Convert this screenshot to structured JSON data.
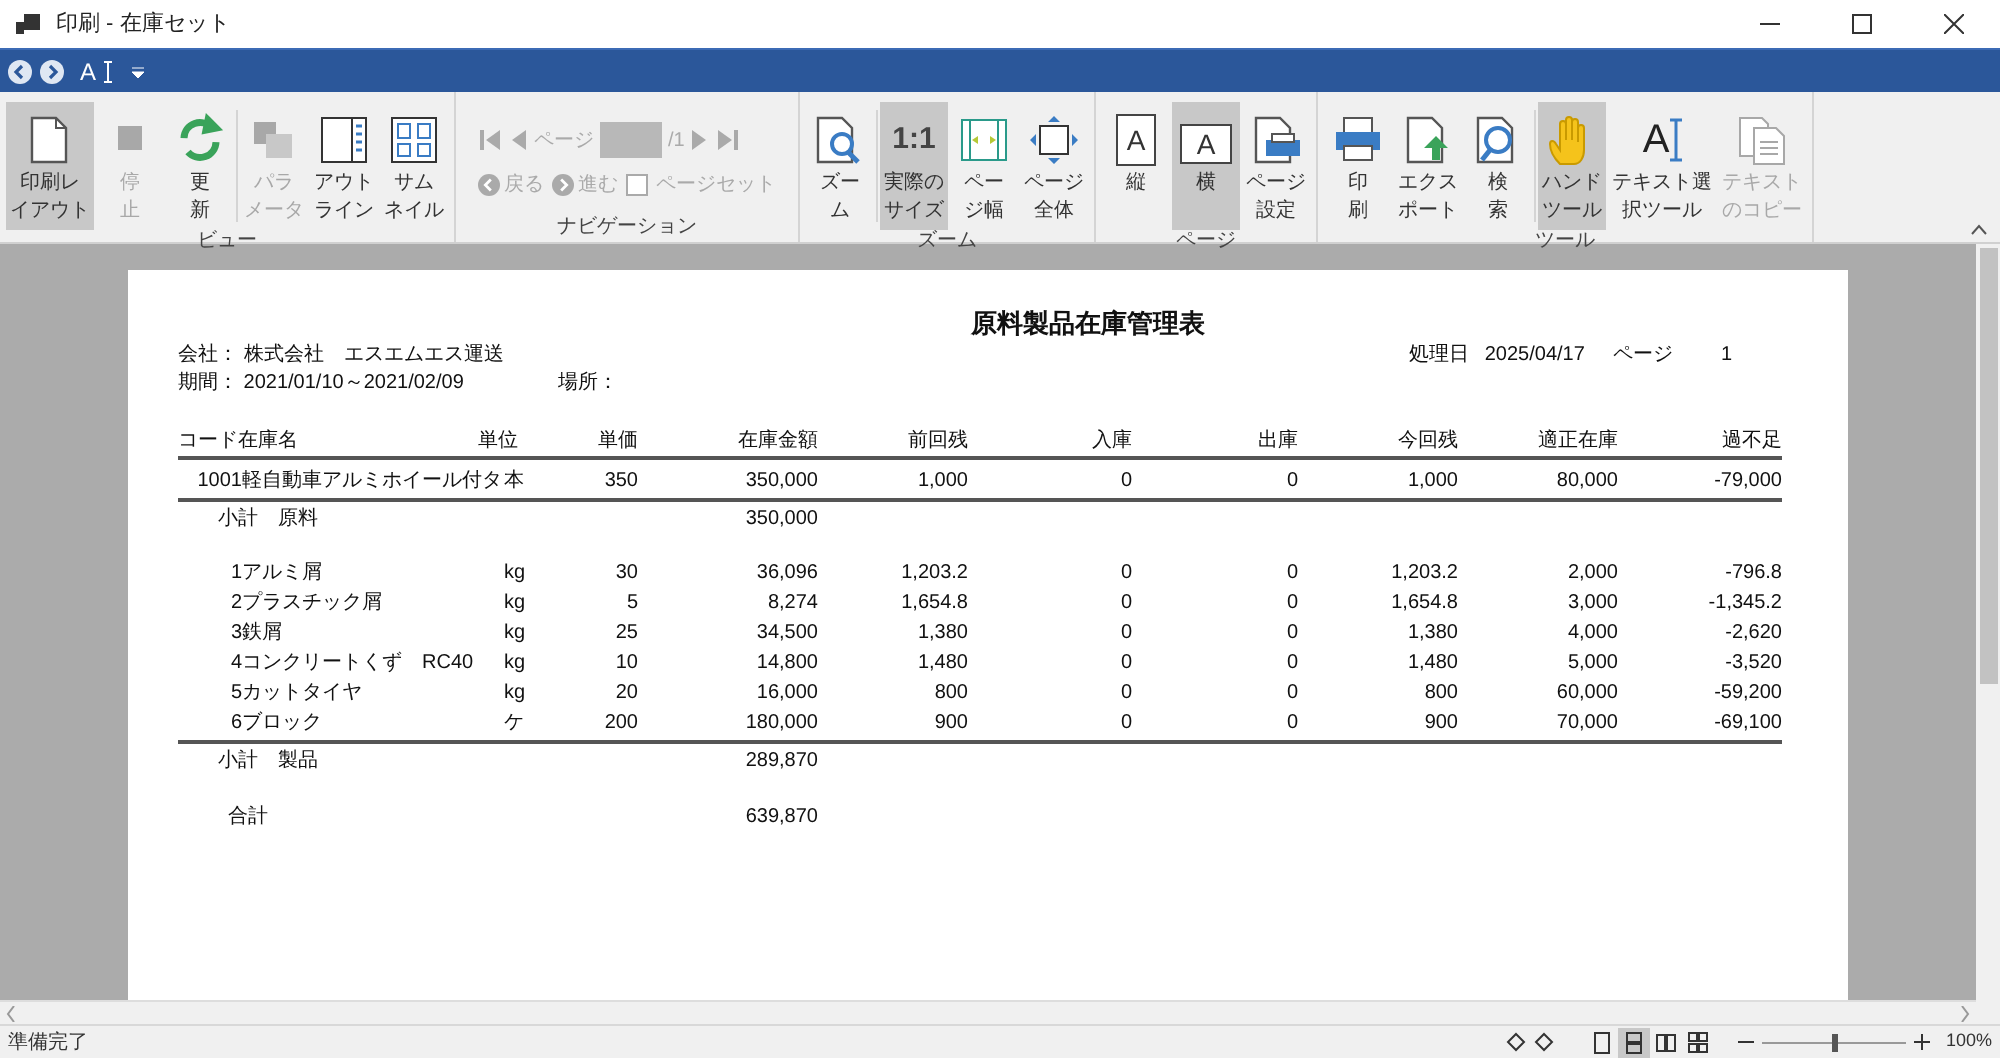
{
  "window": {
    "title": "印刷 - 在庫セット"
  },
  "quick_access": {
    "text_tool_glyph": "A"
  },
  "ribbon": {
    "groups": [
      {
        "label": "ビュー",
        "kind": "buttons",
        "items": [
          {
            "kind": "layout",
            "label_lines": [
              "印刷レ",
              "イアウト"
            ],
            "selected": true,
            "disabled": false
          },
          {
            "kind": "stop",
            "label_lines": [
              "停",
              "止"
            ],
            "selected": false,
            "disabled": true
          },
          {
            "kind": "refresh",
            "label_lines": [
              "更",
              "新"
            ],
            "selected": false,
            "disabled": false
          },
          {
            "kind": "params",
            "label_lines": [
              "パラ",
              "メータ"
            ],
            "selected": false,
            "disabled": true,
            "separator_before": true
          },
          {
            "kind": "outline",
            "label_lines": [
              "アウト",
              "ライン"
            ],
            "selected": false,
            "disabled": false
          },
          {
            "kind": "thumbnail",
            "label_lines": [
              "サム",
              "ネイル"
            ],
            "selected": false,
            "disabled": false
          }
        ]
      },
      {
        "label": "ナビゲーション",
        "kind": "navigation",
        "disabled": true,
        "page_label": "ページ",
        "page_total": "/1",
        "back": "戻る",
        "forward": "進む",
        "checkbox": {
          "label": "ページセット",
          "checked": false
        }
      },
      {
        "label": "ズーム",
        "kind": "buttons",
        "items": [
          {
            "kind": "zoom",
            "label_lines": [
              "ズー",
              "ム"
            ],
            "selected": false,
            "disabled": false
          },
          {
            "kind": "actual",
            "glyph": "1:1",
            "label_lines": [
              "実際の",
              "サイズ"
            ],
            "selected": true,
            "disabled": false,
            "separator_before": true
          },
          {
            "kind": "page-width",
            "label_lines": [
              "ペー",
              "ジ幅"
            ],
            "selected": false,
            "disabled": false
          },
          {
            "kind": "page-whole",
            "label_lines": [
              "ページ",
              "全体"
            ],
            "selected": false,
            "disabled": false
          }
        ]
      },
      {
        "label": "ページ",
        "kind": "buttons",
        "items": [
          {
            "kind": "portrait",
            "glyph": "A",
            "label_lines": [
              "縦"
            ],
            "selected": false,
            "disabled": false
          },
          {
            "kind": "landscape",
            "glyph": "A",
            "label_lines": [
              "横"
            ],
            "selected": true,
            "disabled": false
          },
          {
            "kind": "page-setup",
            "label_lines": [
              "ページ",
              "設定"
            ],
            "selected": false,
            "disabled": false
          }
        ]
      },
      {
        "label": "ツール",
        "kind": "buttons",
        "items": [
          {
            "kind": "print",
            "label_lines": [
              "印",
              "刷"
            ],
            "selected": false,
            "disabled": false
          },
          {
            "kind": "export",
            "label_lines": [
              "エクス",
              "ポート"
            ],
            "selected": false,
            "disabled": false
          },
          {
            "kind": "search",
            "label_lines": [
              "検",
              "索"
            ],
            "selected": false,
            "disabled": false
          },
          {
            "kind": "hand",
            "label_lines": [
              "ハンド",
              "ツール"
            ],
            "selected": true,
            "disabled": false,
            "separator_before": true
          },
          {
            "kind": "text-select",
            "glyph": "A",
            "label_lines": [
              "テキスト選",
              "択ツール"
            ],
            "selected": false,
            "disabled": false
          },
          {
            "kind": "copy",
            "label_lines": [
              "テキスト",
              "のコピー"
            ],
            "selected": false,
            "disabled": true
          }
        ]
      }
    ]
  },
  "report": {
    "title": "原料製品在庫管理表",
    "company": "会社： 株式会社　エスエムエス運送",
    "period": "期間： 2021/01/10～2021/02/09",
    "location": "場所：",
    "date_label": "処理日",
    "date": "2025/04/17",
    "page_label": "ページ",
    "page": "1",
    "columns": [
      "コード在庫名",
      "単位",
      "単価",
      "在庫金額",
      "前回残",
      "入庫",
      "出庫",
      "今回残",
      "適正在庫",
      "過不足"
    ],
    "rows": [
      {
        "kind": "item",
        "code": "1001",
        "name": "軽自動車アルミホイール付タ",
        "unit": "本",
        "values": [
          "350",
          "350,000",
          "1,000",
          "0",
          "0",
          "1,000",
          "80,000",
          "-79,000"
        ],
        "rule_below": true
      },
      {
        "kind": "subtotal",
        "label": "小計　原料",
        "amount": "350,000"
      },
      {
        "kind": "item",
        "code": "1",
        "name": "アルミ屑",
        "unit": "kg",
        "values": [
          "30",
          "36,096",
          "1,203.2",
          "0",
          "0",
          "1,203.2",
          "2,000",
          "-796.8"
        ],
        "gap_before": true
      },
      {
        "kind": "item",
        "code": "2",
        "name": "プラスチック屑",
        "unit": "kg",
        "values": [
          "5",
          "8,274",
          "1,654.8",
          "0",
          "0",
          "1,654.8",
          "3,000",
          "-1,345.2"
        ]
      },
      {
        "kind": "item",
        "code": "3",
        "name": "鉄屑",
        "unit": "kg",
        "values": [
          "25",
          "34,500",
          "1,380",
          "0",
          "0",
          "1,380",
          "4,000",
          "-2,620"
        ]
      },
      {
        "kind": "item",
        "code": "4",
        "name": "コンクリートくず　RC40",
        "unit": "kg",
        "values": [
          "10",
          "14,800",
          "1,480",
          "0",
          "0",
          "1,480",
          "5,000",
          "-3,520"
        ]
      },
      {
        "kind": "item",
        "code": "5",
        "name": "カットタイヤ",
        "unit": "kg",
        "values": [
          "20",
          "16,000",
          "800",
          "0",
          "0",
          "800",
          "60,000",
          "-59,200"
        ]
      },
      {
        "kind": "item",
        "code": "6",
        "name": "ブロック",
        "unit": "ケ",
        "values": [
          "200",
          "180,000",
          "900",
          "0",
          "0",
          "900",
          "70,000",
          "-69,100"
        ],
        "rule_below": true
      },
      {
        "kind": "subtotal",
        "label": "小計　製品",
        "amount": "289,870"
      },
      {
        "kind": "total",
        "label": "合計",
        "amount": "639,870",
        "gap_before": true
      }
    ]
  },
  "status_bar": {
    "text": "準備完了",
    "view_modes": [
      {
        "selected": false
      },
      {
        "selected": true
      },
      {
        "selected": false
      },
      {
        "selected": false
      }
    ],
    "zoom": {
      "level": 0.5,
      "reading": "100%"
    }
  }
}
